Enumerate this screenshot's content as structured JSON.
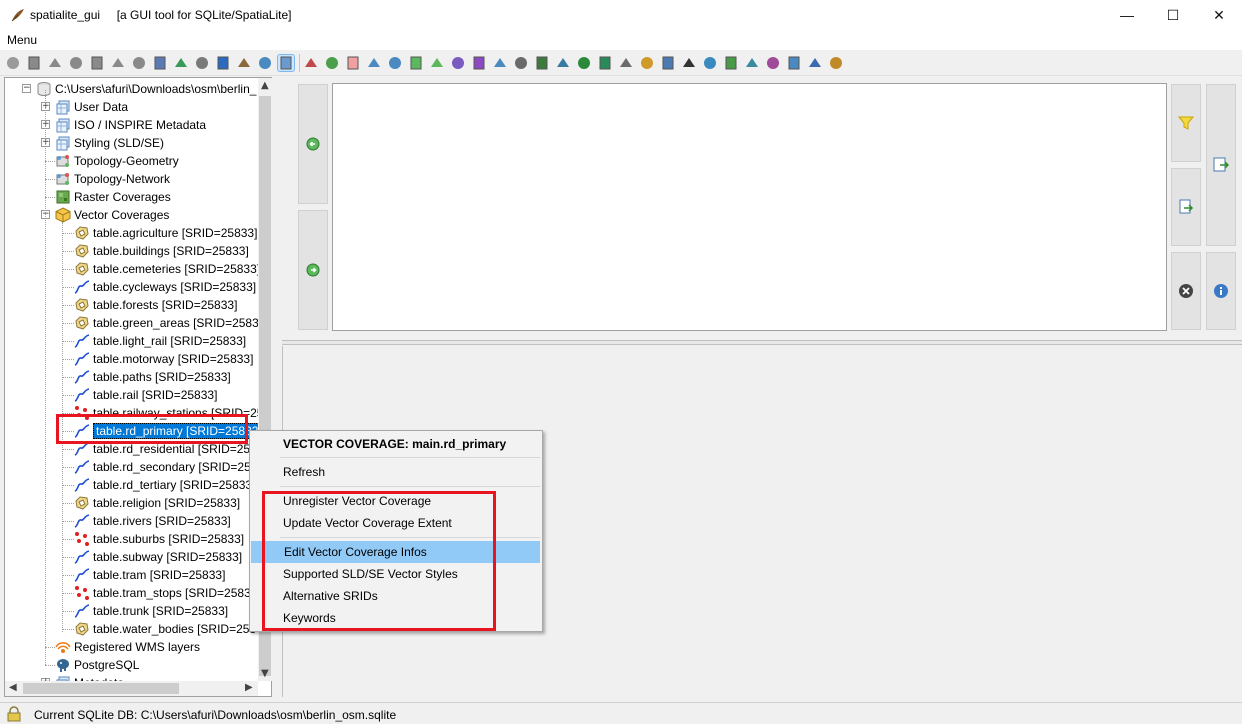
{
  "window": {
    "title": "spatialite_gui     [a GUI tool for SQLite/SpatiaLite]",
    "minimize": "—",
    "maximize": "☐",
    "close": "✕"
  },
  "menubar": {
    "menu_label": "Menu"
  },
  "tree": {
    "root_label": "C:\\Users\\afuri\\Downloads\\osm\\berlin_",
    "nodes": [
      {
        "label": "User Data",
        "icon": "table-group-icon"
      },
      {
        "label": "ISO / INSPIRE Metadata",
        "icon": "table-group-icon"
      },
      {
        "label": "Styling (SLD/SE)",
        "icon": "table-group-icon"
      },
      {
        "label": "Topology-Geometry",
        "icon": "topology-icon"
      },
      {
        "label": "Topology-Network",
        "icon": "topology-icon"
      },
      {
        "label": "Raster Coverages",
        "icon": "raster-icon"
      },
      {
        "label": "Vector Coverages",
        "icon": "cube-icon"
      }
    ],
    "coverages": [
      {
        "label": "table.agriculture [SRID=25833]",
        "icon": "polygon-icon"
      },
      {
        "label": "table.buildings [SRID=25833]",
        "icon": "polygon-icon"
      },
      {
        "label": "table.cemeteries [SRID=25833]",
        "icon": "polygon-icon"
      },
      {
        "label": "table.cycleways [SRID=25833]",
        "icon": "line-icon"
      },
      {
        "label": "table.forests [SRID=25833]",
        "icon": "polygon-icon"
      },
      {
        "label": "table.green_areas [SRID=25833]",
        "icon": "polygon-icon"
      },
      {
        "label": "table.light_rail [SRID=25833]",
        "icon": "line-icon"
      },
      {
        "label": "table.motorway [SRID=25833]",
        "icon": "line-icon"
      },
      {
        "label": "table.paths [SRID=25833]",
        "icon": "line-icon"
      },
      {
        "label": "table.rail [SRID=25833]",
        "icon": "line-icon"
      },
      {
        "label": "table.railway_stations [SRID=25",
        "icon": "point-icon"
      },
      {
        "label": "table.rd_primary [SRID=25833",
        "icon": "line-icon"
      },
      {
        "label": "table.rd_residential [SRID=258",
        "icon": "line-icon"
      },
      {
        "label": "table.rd_secondary [SRID=258",
        "icon": "line-icon"
      },
      {
        "label": "table.rd_tertiary [SRID=25833]",
        "icon": "line-icon"
      },
      {
        "label": "table.religion [SRID=25833]",
        "icon": "polygon-icon"
      },
      {
        "label": "table.rivers [SRID=25833]",
        "icon": "line-icon"
      },
      {
        "label": "table.suburbs [SRID=25833]",
        "icon": "point-icon"
      },
      {
        "label": "table.subway [SRID=25833]",
        "icon": "line-icon"
      },
      {
        "label": "table.tram [SRID=25833]",
        "icon": "line-icon"
      },
      {
        "label": "table.tram_stops [SRID=25833",
        "icon": "point-icon"
      },
      {
        "label": "table.trunk [SRID=25833]",
        "icon": "line-icon"
      },
      {
        "label": "table.water_bodies [SRID=258",
        "icon": "polygon-icon"
      }
    ],
    "tail_nodes": [
      {
        "label": "Registered WMS layers",
        "icon": "wms-icon"
      },
      {
        "label": "PostgreSQL",
        "icon": "postgresql-icon"
      },
      {
        "label": "Metadata",
        "icon": "table-group-icon"
      }
    ],
    "selected_index": 11
  },
  "context_menu": {
    "header": "VECTOR COVERAGE: main.rd_primary",
    "items": [
      "Refresh",
      "Unregister Vector Coverage",
      "Update Vector Coverage Extent",
      "Edit Vector Coverage Infos",
      "Supported SLD/SE Vector Styles",
      "Alternative SRIDs",
      "Keywords"
    ],
    "highlighted": "Edit Vector Coverage Infos"
  },
  "statusbar": {
    "text": "Current SQLite DB: C:\\Users\\afuri\\Downloads\\osm\\berlin_osm.sqlite"
  },
  "colors": {
    "selection": "#0078d7",
    "menu_highlight": "#91c9f7",
    "annotation_red": "#e8141f"
  }
}
